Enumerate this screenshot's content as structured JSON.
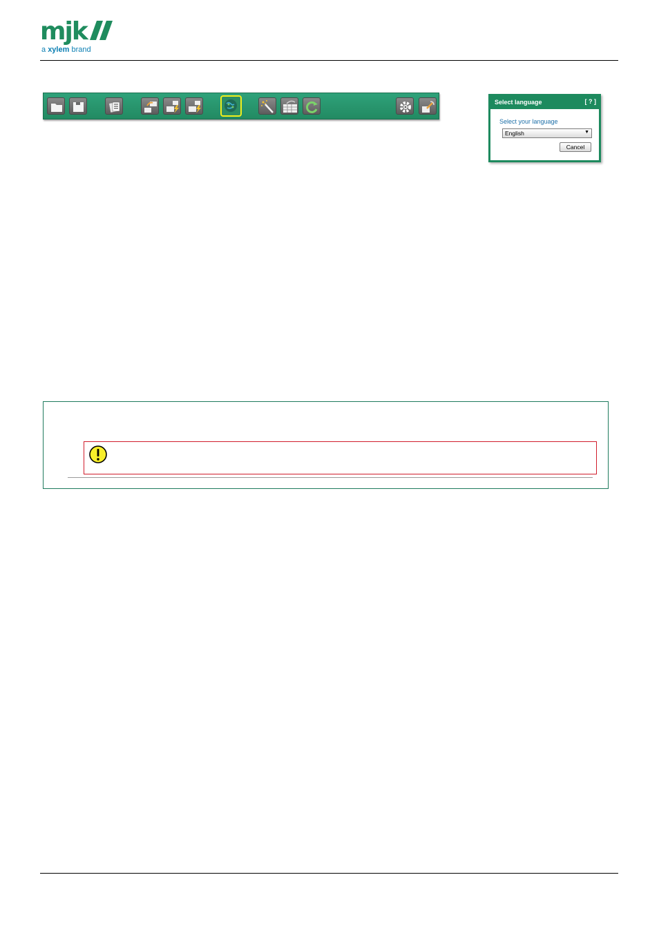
{
  "logo": {
    "word": "mjk",
    "tagline_prefix": "a ",
    "tagline_brand": "xylem",
    "tagline_suffix": " brand"
  },
  "toolbar": {
    "buttons": [
      {
        "name": "open-folder-button",
        "icon": "folder-icon"
      },
      {
        "name": "save-button",
        "icon": "floppy-disk-icon"
      },
      {
        "name": "documents-button",
        "icon": "documents-icon"
      },
      {
        "name": "device-connect-button",
        "icon": "computer-transfer-icon"
      },
      {
        "name": "device-read-button",
        "icon": "computer-lightning-icon"
      },
      {
        "name": "device-write-button",
        "icon": "computer-lightning-icon"
      },
      {
        "name": "world-language-button",
        "icon": "globe-icon",
        "active": true
      },
      {
        "name": "wizard-button",
        "icon": "magic-wand-icon"
      },
      {
        "name": "table-button",
        "icon": "table-grid-icon"
      },
      {
        "name": "refresh-button",
        "icon": "refresh-icon"
      },
      {
        "name": "settings-button",
        "icon": "gear-icon"
      },
      {
        "name": "exit-button",
        "icon": "exit-icon"
      }
    ],
    "active_highlight_color": "#f2ef1c",
    "background_color": "#27966d"
  },
  "dialog": {
    "title": "Select language",
    "help": "[ ? ]",
    "label": "Select your language",
    "selected_language": "English",
    "cancel_label": "Cancel"
  },
  "note": {
    "warning_icon": "exclamation-warning-icon",
    "border_color": "#1d7a5c",
    "warning_border_color": "#d01b2a"
  }
}
